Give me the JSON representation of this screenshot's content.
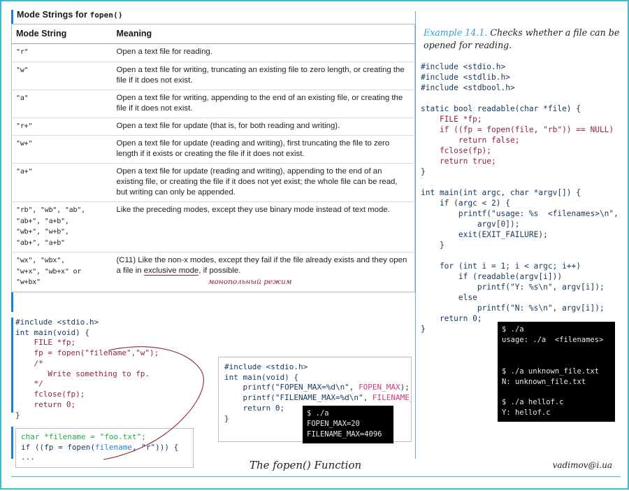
{
  "slide": {
    "footer_title": "The fopen() Function",
    "footer_email": "vadimov@i.ua",
    "accent_color": "#3fb8c8",
    "rule_color": "#1f7fd0"
  },
  "table": {
    "caption_prefix": "Mode Strings for ",
    "caption_code": "fopen()",
    "headers": [
      "Mode String",
      "Meaning"
    ],
    "rows": [
      {
        "mode": "\"r\"",
        "meaning": "Open a text file for reading."
      },
      {
        "mode": "\"w\"",
        "meaning": "Open a text file for writing, truncating an existing file to zero length, or creating the file if it does not exist."
      },
      {
        "mode": "\"a\"",
        "meaning": "Open a text file for writing, appending to the end of an existing file, or creating the file if it does not exist."
      },
      {
        "mode": "\"r+\"",
        "meaning": "Open a text file for update (that is, for both reading and writing)."
      },
      {
        "mode": "\"w+\"",
        "meaning": "Open a text file for update (reading and writing), first truncating the file to zero length if it exists or creating the file if it does not exist."
      },
      {
        "mode": "\"a+\"",
        "meaning": "Open a text file for update (reading and writing), appending to the end of an existing file, or creating the file if it does not yet exist; the whole file can be read, but writing can only be appended."
      },
      {
        "mode": "\"rb\", \"wb\", \"ab\",\n\"ab+\", \"a+b\",\n\"wb+\", \"w+b\",\n\"ab+\", \"a+b\"",
        "meaning": "Like the preceding modes, except they use binary mode instead of  text mode."
      },
      {
        "mode": "\"wx\", \"wbx\",\n\"w+x\", \"wb+x\" or\n\"w+bx\"",
        "meaning_part1": "(C11) Like the non-x modes, except they fail if the file already exists and they open a file in ",
        "meaning_underlined": "exclusive mode",
        "meaning_part2": ", if possible.",
        "annotation_ru": "монопольный режим",
        "annotation_color": "#8e2341"
      }
    ]
  },
  "snippet_left": {
    "line1": "#include <stdio.h>",
    "line2": "int main(void) {",
    "line3": "    FILE *fp;",
    "line4": "    fp = fopen(\"filename\",\"w\");",
    "line5": "    /*",
    "line6": "       Write something to fp.",
    "line7": "    */",
    "line8": "    fclose(fp);",
    "line9": "    return 0;",
    "line10": "}"
  },
  "boxed_left": {
    "line1_a": "char",
    "line1_b": " *filename = ",
    "line1_c": "\"foo.txt\";",
    "line2_a": "if ((fp = fopen(",
    "line2_b": "filename",
    "line2_c": ", ",
    "line2_d": "\"r\"",
    "line2_e": "))) {",
    "line3": "..."
  },
  "boxed_mid": {
    "line1": "#include <stdio.h>",
    "line2": "int main(void) {",
    "line3_a": "    printf(\"FOPEN_MAX=%d\\n\", ",
    "line3_b": "FOPEN_MAX",
    "line3_c": ");",
    "line4_a": "    printf(\"FILENAME_MAX=%d\\n\", ",
    "line4_b": "FILENAME_MAX",
    "line4_c": ");",
    "line5": "    return 0;",
    "line6": "}"
  },
  "terminal_mid": {
    "lines": "$ ./a\nFOPEN_MAX=20\nFILENAME_MAX=4096"
  },
  "terminal_right": {
    "lines": "$ ./a\nusage: ./a  <filenames>\n\n\n$ ./a unknown_file.txt\nN: unknown_file.txt\n\n$ ./a hellof.c\nY: hellof.c"
  },
  "example": {
    "label": "Example 14.1.",
    "caption": " Checks whether a file can be opened for reading.",
    "code_block_1": "#include <stdio.h>\n#include <stdlib.h>\n#include <stdbool.h>\n\nstatic bool readable(char *file) {",
    "code_red": "    FILE *fp;\n    if ((fp = fopen(file, \"rb\")) == NULL)\n        return false;\n    fclose(fp);\n    return true;",
    "code_block_2": "}\n\nint main(int argc, char *argv[]) {\n    if (argc < 2) {\n        printf(\"usage: %s  <filenames>\\n\",\n            argv[0]);\n        exit(EXIT_FAILURE);\n    }\n\n    for (int i = 1; i < argc; i++)\n        if (readable(argv[i]))\n            printf(\"Y: %s\\n\", argv[i]);\n        else\n            printf(\"N: %s\\n\", argv[i]);\n    return 0;\n}"
  }
}
